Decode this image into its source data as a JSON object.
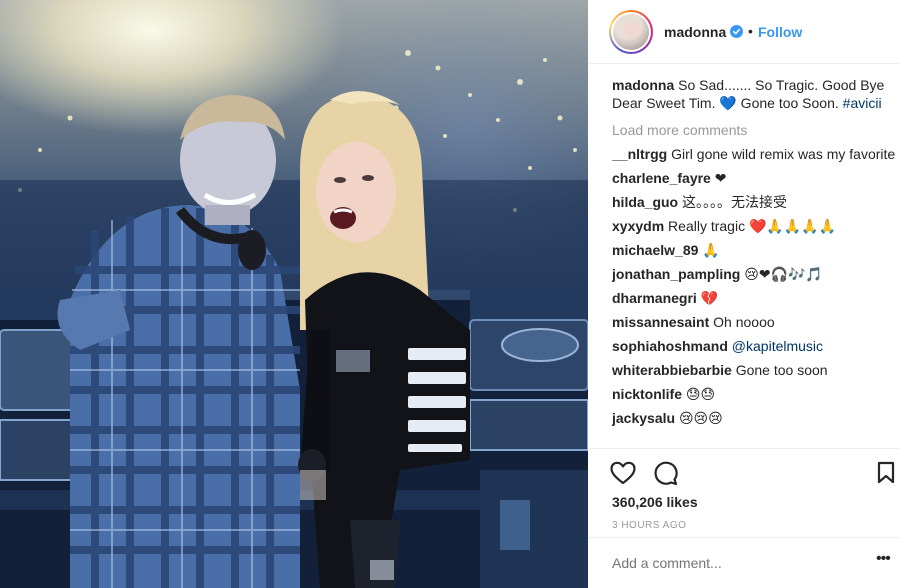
{
  "post": {
    "username": "madonna",
    "follow_label": "Follow",
    "dot": "•",
    "caption_user": "madonna",
    "caption_text": "So Sad....... So Tragic. Good Bye Dear Sweet Tim. 💙  Gone too Soon.",
    "caption_tag": "#avicii",
    "load_more": "Load more comments",
    "comments": [
      {
        "user": "__nltrgg",
        "text": "Girl gone wild remix was my favorite"
      },
      {
        "user": "charlene_fayre",
        "text": "❤"
      },
      {
        "user": "hilda_guo",
        "text": "这。。。。无法接受"
      },
      {
        "user": "xyxydm",
        "text": "Really tragic ❤️🙏🙏🙏🙏"
      },
      {
        "user": "michaelw_89",
        "text": "🙏"
      },
      {
        "user": "jonathan_pampling",
        "text": "😢❤🎧🎶🎵"
      },
      {
        "user": "dharmanegri",
        "text": "💔"
      },
      {
        "user": "missannesaint",
        "text": "Oh noooo"
      },
      {
        "user": "sophiahoshmand",
        "text": "@kapitelmusic"
      },
      {
        "user": "whiterabbiebarbie",
        "text": "Gone too soon"
      },
      {
        "user": "nicktonlife",
        "text": "😓😓"
      },
      {
        "user": "jackysalu",
        "text": "😢😢😢"
      }
    ],
    "likes": "360,206 likes",
    "time_ago": "3 HOURS AGO",
    "add_comment_placeholder": "Add a comment...",
    "more_label": "•••"
  },
  "colors": {
    "link_blue": "#3897f0",
    "hashtag": "#003569",
    "muted": "#999999",
    "text": "#262626"
  },
  "icons": {
    "verified": "verified-badge-icon",
    "like": "heart-outline-icon",
    "comment": "speech-bubble-icon",
    "save": "bookmark-icon",
    "more": "ellipsis-icon"
  }
}
